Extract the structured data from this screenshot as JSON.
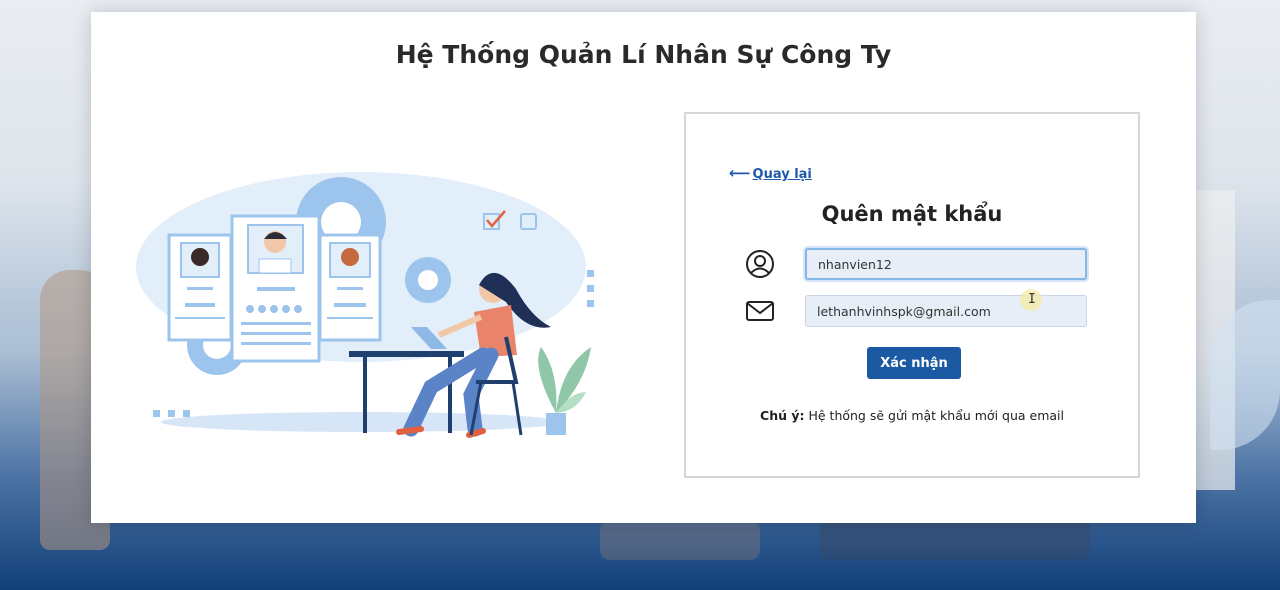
{
  "header": {
    "title": "Hệ Thống Quản Lí Nhân Sự Công Ty"
  },
  "form": {
    "back_label": "Quay lại",
    "back_arrow": "⟵",
    "title": "Quên mật khẩu",
    "username": {
      "value": "nhanvien12",
      "icon": "user-circle-icon"
    },
    "email": {
      "value": "lethanhvinhspk@gmail.com",
      "icon": "envelope-icon"
    },
    "submit_label": "Xác nhận",
    "note_label": "Chú ý:",
    "note_text": " Hệ thống sẽ gửi mật khẩu mới qua email"
  },
  "colors": {
    "primary": "#1b5aa3",
    "link": "#1f5aa8",
    "field_bg": "#e8eef7",
    "illustration_blue": "#9cc4ec"
  }
}
